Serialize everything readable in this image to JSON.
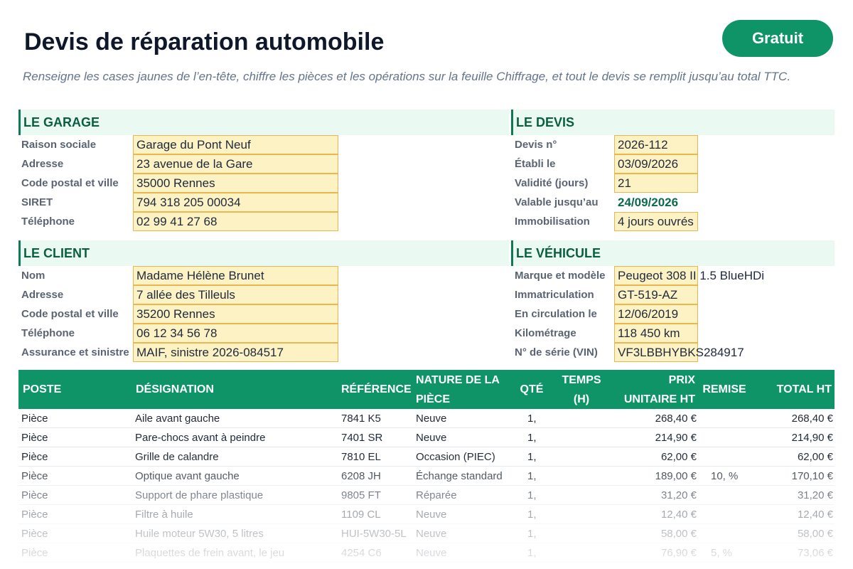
{
  "header": {
    "title": "Devis de réparation automobile",
    "badge": "Gratuit",
    "subtitle": "Renseigne les cases jaunes de l’en-tête, chiffre les pièces et les opérations sur la feuille Chiffrage, et tout le devis se remplit jusqu’au total TTC."
  },
  "garage": {
    "heading": "LE GARAGE",
    "fields": [
      {
        "label": "Raison sociale",
        "value": "Garage du Pont Neuf"
      },
      {
        "label": "Adresse",
        "value": "23 avenue de la Gare"
      },
      {
        "label": "Code postal et ville",
        "value": "35000 Rennes"
      },
      {
        "label": "SIRET",
        "value": "794 318 205 00034"
      },
      {
        "label": "Téléphone",
        "value": "02 99 41 27 68"
      }
    ]
  },
  "devis": {
    "heading": "LE DEVIS",
    "fields": [
      {
        "label": "Devis n°",
        "value": "2026-112"
      },
      {
        "label": "Établi le",
        "value": "03/09/2026"
      },
      {
        "label": "Validité (jours)",
        "value": "21"
      },
      {
        "label": "Valable jusqu’au",
        "value": "24/09/2026"
      },
      {
        "label": "Immobilisation",
        "value": "4 jours ouvrés"
      }
    ]
  },
  "client": {
    "heading": "LE CLIENT",
    "fields": [
      {
        "label": "Nom",
        "value": "Madame Hélène Brunet"
      },
      {
        "label": "Adresse",
        "value": "7 allée des Tilleuls"
      },
      {
        "label": "Code postal et ville",
        "value": "35200 Rennes"
      },
      {
        "label": "Téléphone",
        "value": "06 12 34 56 78"
      },
      {
        "label": "Assurance et sinistre",
        "value": "MAIF, sinistre 2026-084517"
      }
    ]
  },
  "vehicule": {
    "heading": "LE VÉHICULE",
    "fields": [
      {
        "label": "Marque et modèle",
        "value": "Peugeot 308 II 1.5 BlueHDi"
      },
      {
        "label": "Immatriculation",
        "value": "GT-519-AZ"
      },
      {
        "label": "En circulation le",
        "value": "12/06/2019"
      },
      {
        "label": "Kilométrage",
        "value": "118 450 km"
      },
      {
        "label": "N° de série (VIN)",
        "value": "VF3LBBHYBKS284917"
      }
    ]
  },
  "table": {
    "headers": {
      "poste": "POSTE",
      "designation": "DÉSIGNATION",
      "reference": "RÉFÉRENCE",
      "nature_1": "NATURE DE LA",
      "nature_2": "PIÈCE",
      "qte": "QTÉ",
      "temps_1": "TEMPS",
      "temps_2": "(H)",
      "prix_1": "PRIX",
      "prix_2": "UNITAIRE HT",
      "remise": "REMISE",
      "total": "TOTAL HT"
    },
    "rows": [
      {
        "poste": "Pièce",
        "designation": "Aile avant gauche",
        "reference": "7841 K5",
        "nature": "Neuve",
        "qte": "1,",
        "temps": "",
        "prix": "268,40 €",
        "remise": "",
        "total": "268,40 €"
      },
      {
        "poste": "Pièce",
        "designation": "Pare-chocs avant à peindre",
        "reference": "7401 SR",
        "nature": "Neuve",
        "qte": "1,",
        "temps": "",
        "prix": "214,90 €",
        "remise": "",
        "total": "214,90 €"
      },
      {
        "poste": "Pièce",
        "designation": "Grille de calandre",
        "reference": "7810 EL",
        "nature": "Occasion (PIEC)",
        "qte": "1,",
        "temps": "",
        "prix": "62,00 €",
        "remise": "",
        "total": "62,00 €"
      },
      {
        "poste": "Pièce",
        "designation": "Optique avant gauche",
        "reference": "6208 JH",
        "nature": "Échange standard",
        "qte": "1,",
        "temps": "",
        "prix": "189,00 €",
        "remise": "10, %",
        "total": "170,10 €"
      },
      {
        "poste": "Pièce",
        "designation": "Support de phare plastique",
        "reference": "9805 FT",
        "nature": "Réparée",
        "qte": "1,",
        "temps": "",
        "prix": "31,20 €",
        "remise": "",
        "total": "31,20 €"
      },
      {
        "poste": "Pièce",
        "designation": "Filtre à huile",
        "reference": "1109 CL",
        "nature": "Neuve",
        "qte": "1,",
        "temps": "",
        "prix": "12,40 €",
        "remise": "",
        "total": "12,40 €"
      },
      {
        "poste": "Pièce",
        "designation": "Huile moteur 5W30, 5 litres",
        "reference": "HUI-5W30-5L",
        "nature": "Neuve",
        "qte": "1,",
        "temps": "",
        "prix": "58,00 €",
        "remise": "",
        "total": "58,00 €"
      },
      {
        "poste": "Pièce",
        "designation": "Plaquettes de frein avant, le jeu",
        "reference": "4254 C6",
        "nature": "Neuve",
        "qte": "1,",
        "temps": "",
        "prix": "76,90 €",
        "remise": "5, %",
        "total": "73,06 €"
      }
    ]
  }
}
